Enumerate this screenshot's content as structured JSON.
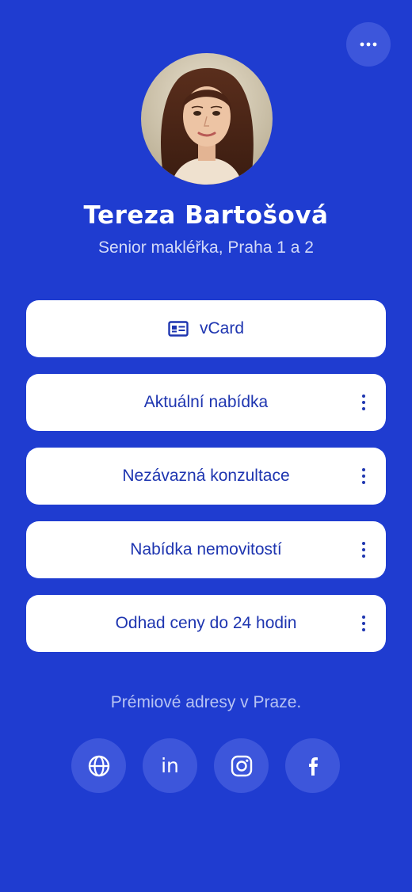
{
  "menu": {
    "icon": "more-horizontal-icon"
  },
  "profile": {
    "avatar_icon": "profile-photo",
    "name": "Tereza Bartošová",
    "subtitle": "Senior makléřka, Praha 1 a 2"
  },
  "links": [
    {
      "label": "vCard",
      "icon": "id-card-icon",
      "has_menu": false
    },
    {
      "label": "Aktuální nabídka",
      "has_menu": true
    },
    {
      "label": "Nezávazná konzultace",
      "has_menu": true
    },
    {
      "label": "Nabídka nemovitostí",
      "has_menu": true
    },
    {
      "label": "Odhad ceny do 24 hodin",
      "has_menu": true
    }
  ],
  "tagline": "Prémiové adresy v Praze.",
  "socials": [
    {
      "icon": "globe-icon"
    },
    {
      "icon": "linkedin-icon",
      "text": "in"
    },
    {
      "icon": "instagram-icon"
    },
    {
      "icon": "facebook-icon"
    }
  ],
  "colors": {
    "background": "#1f3cd0",
    "button_bg": "#ffffff",
    "button_text": "#1e35b0",
    "circle_bg": "#3d56db"
  }
}
